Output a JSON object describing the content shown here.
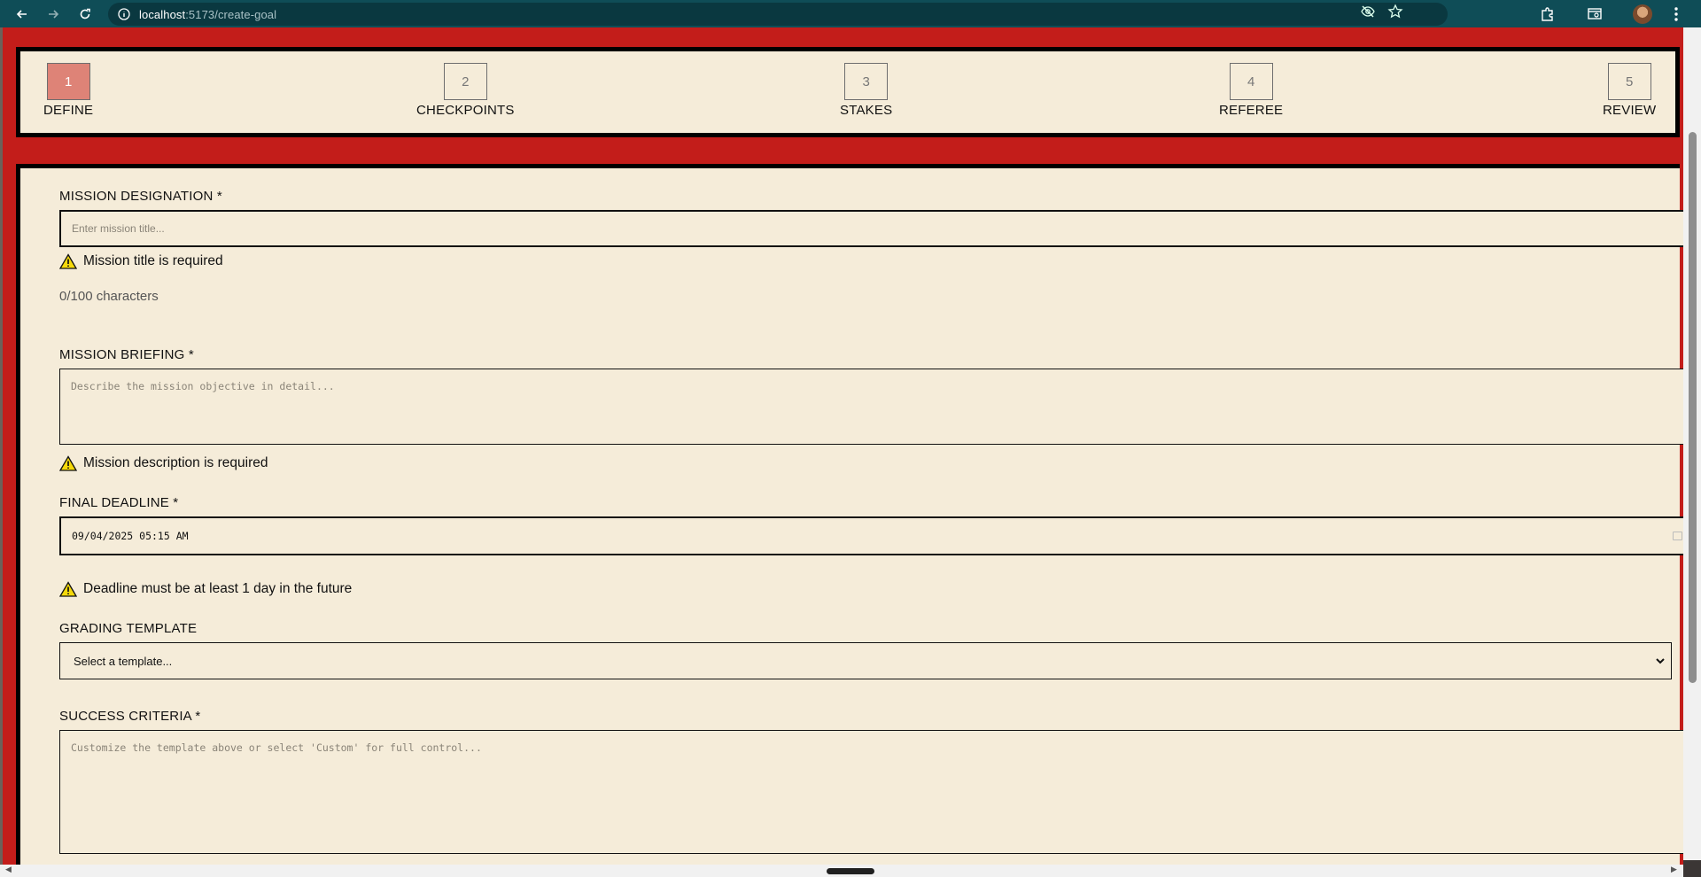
{
  "browser": {
    "url_host": "localhost",
    "url_path": ":5173/create-goal"
  },
  "stepper": {
    "steps": [
      {
        "number": "1",
        "label": "DEFINE"
      },
      {
        "number": "2",
        "label": "CHECKPOINTS"
      },
      {
        "number": "3",
        "label": "STAKES"
      },
      {
        "number": "4",
        "label": "REFEREE"
      },
      {
        "number": "5",
        "label": "REVIEW"
      }
    ],
    "active_step": 1
  },
  "form": {
    "title_field": {
      "label": "MISSION DESIGNATION *",
      "value": "",
      "placeholder": "Enter mission title...",
      "error": "Mission title is required",
      "char_count": "0/100 characters"
    },
    "description_field": {
      "label": "MISSION BRIEFING *",
      "value": "",
      "placeholder": "Describe the mission objective in detail...",
      "error": "Mission description is required"
    },
    "deadline_field": {
      "label": "FINAL DEADLINE *",
      "value": "09/04/2025 05:15 AM",
      "error": "Deadline must be at least 1 day in the future"
    },
    "template_field": {
      "label": "GRADING TEMPLATE",
      "selected": "Select a template..."
    },
    "criteria_field": {
      "label": "SUCCESS CRITERIA *",
      "value": "",
      "placeholder": "Customize the template above or select 'Custom' for full control..."
    }
  },
  "colors": {
    "page_background": "#c31d1a",
    "panel_background": "#f5ecd9",
    "active_step": "#de8377",
    "chrome": "#0f4d57"
  }
}
